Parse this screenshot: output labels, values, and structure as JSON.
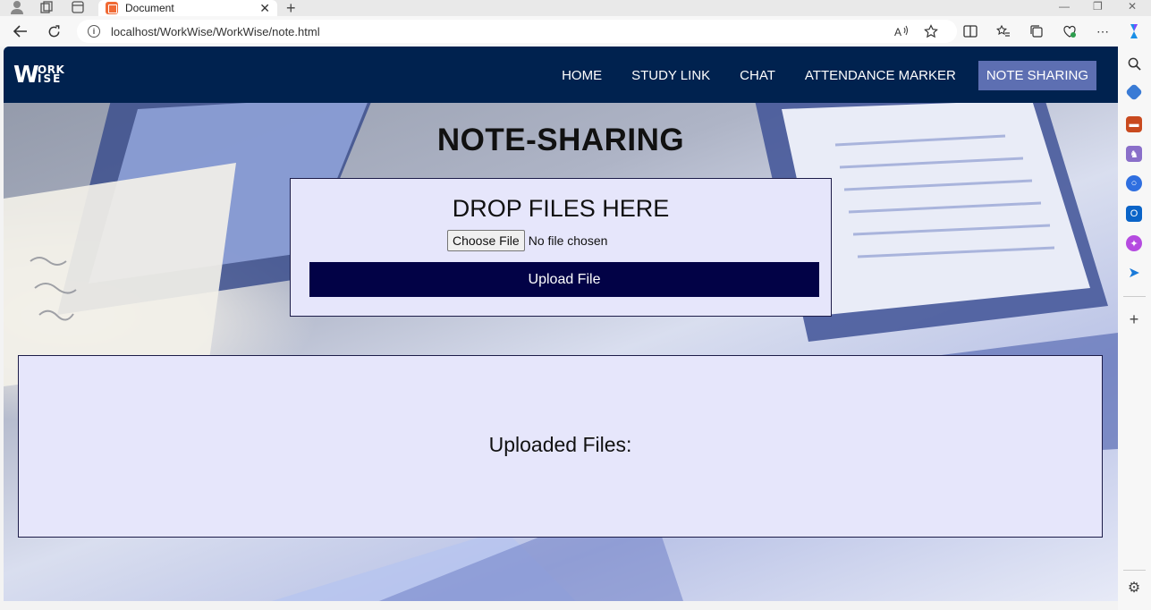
{
  "browser": {
    "tab_title": "Document",
    "url": "localhost/WorkWise/WorkWise/note.html"
  },
  "site": {
    "logo_line1": "W",
    "logo_ork": "ORK",
    "logo_ise": "ISE",
    "nav": [
      {
        "label": "HOME",
        "active": false
      },
      {
        "label": "STUDY LINK",
        "active": false
      },
      {
        "label": "CHAT",
        "active": false
      },
      {
        "label": "ATTENDANCE MARKER",
        "active": false
      },
      {
        "label": "NOTE SHARING",
        "active": true
      }
    ]
  },
  "main": {
    "title": "NOTE-SHARING",
    "drop_title": "DROP FILES HERE",
    "choose_label": "Choose File",
    "no_file": "No file chosen",
    "upload_label": "Upload File",
    "uploaded_title": "Uploaded Files:"
  },
  "colors": {
    "navbar": "#00224f",
    "active_nav": "#5d6fb2",
    "upload_button": "#020246",
    "card_bg": "#e6e6fb"
  }
}
